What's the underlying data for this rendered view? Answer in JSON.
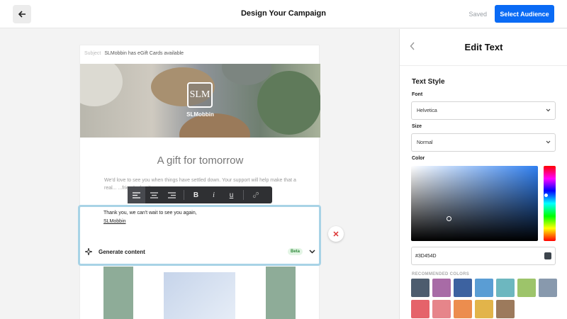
{
  "header": {
    "title": "Design Your Campaign",
    "saved": "Saved",
    "cta": "Select Audience"
  },
  "email": {
    "subject_label": "Subject",
    "subject": "SLMobbin has eGift Cards available",
    "logo_mark": "SLM",
    "brand": "SLMobbin",
    "headline": "A gift for tomorrow",
    "body": "We'd love to see you when things have settled down. Your support will help make that a real...                                    ...friends, family, or g...",
    "edit_line1": "Thank you, we can't wait to see you again,",
    "edit_line2": "SLMobbin",
    "generate_label": "Generate content",
    "beta": "Beta"
  },
  "toolbar": {
    "bold": "B",
    "italic": "i",
    "underline": "u"
  },
  "panel": {
    "title": "Edit Text",
    "section": "Text Style",
    "font_label": "Font",
    "font_value": "Helvetica",
    "size_label": "Size",
    "size_value": "Normal",
    "color_label": "Color",
    "hex": "#3D454D",
    "recommended_label": "RECOMMENDED COLORS",
    "swatches": [
      "#4d5c6e",
      "#a86ba6",
      "#3d62a0",
      "#5a9dd4",
      "#6db7bf",
      "#9dc46a",
      "#8899ad",
      "#e5636a",
      "#e6858a",
      "#ec8d4e",
      "#e2b44a",
      "#9c7a5c"
    ]
  }
}
